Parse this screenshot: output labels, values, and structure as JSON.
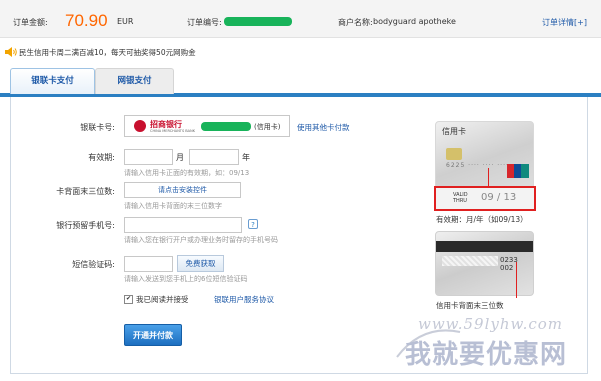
{
  "header": {
    "amount_label": "订单金额:",
    "amount": "70.90",
    "currency": "EUR",
    "order_no_label": "订单编号:",
    "merchant_label": "商户名称:",
    "merchant_name": "bodyguard apotheke",
    "detail_link": "订单详情[+]"
  },
  "notice": "民生信用卡周二满百减10，每天可抽奖得50元网购金",
  "tabs": [
    {
      "label": "银联卡支付",
      "active": true
    },
    {
      "label": "网银支付",
      "active": false
    }
  ],
  "form": {
    "card_label": "银联卡号:",
    "bank_name": "招商银行",
    "bank_en": "CHINA MERCHANTS BANK",
    "card_suffix": "(信用卡)",
    "other_card_link": "使用其他卡付款",
    "expiry_label": "有效期:",
    "month_unit": "月",
    "year_unit": "年",
    "expiry_hint": "请输入信用卡正面的有效期，如：09/13",
    "cvv_label": "卡背面末三位数:",
    "install_button": "请点击安装控件",
    "cvv_hint": "请输入信用卡背面的末三位数字",
    "phone_label": "银行预留手机号:",
    "help_icon": "?",
    "phone_hint": "请输入您在银行开户或办理业务时留存的手机号码",
    "sms_label": "短信验证码:",
    "sms_button": "免费获取",
    "sms_hint": "请输入发送到您手机上的6位短信验证码",
    "agree_check": "✔",
    "agree_text": "我已阅读并接受",
    "agree_link": "银联用户服务协议",
    "submit_button": "开通并付款"
  },
  "card_front": {
    "title": "信用卡",
    "number": "6225 ···· ···· ····",
    "valid_label": "VALID THRU",
    "valid_date": "09 / 13",
    "caption": "有效期：月/年（如09/13）"
  },
  "card_back": {
    "cvv": "0233 002",
    "caption": "信用卡背面末三位数"
  },
  "watermark": {
    "url": "www.59lyhw.com",
    "text": "我就要优惠网"
  },
  "colors": {
    "accent": "#ff6600",
    "link": "#1f5aa8",
    "tab_bar": "#2b7fc2",
    "highlight": "#e02020"
  }
}
